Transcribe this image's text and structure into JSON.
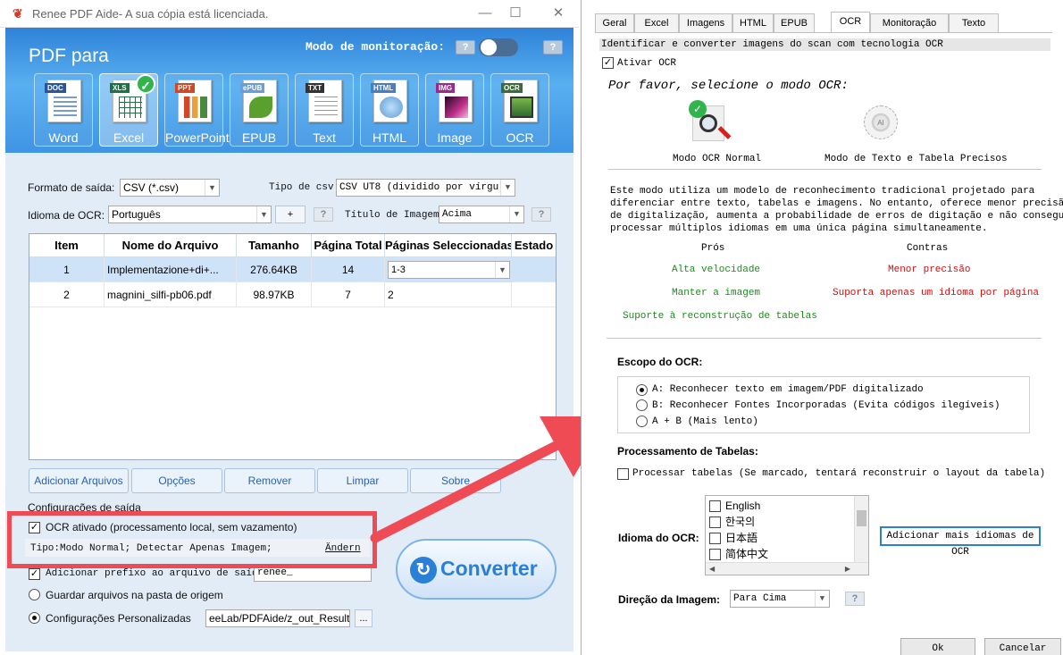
{
  "left_window": {
    "title": "Renee PDF Aide- A sua cópia está licenciada.",
    "app_icon": "renee-logo-icon",
    "banner": {
      "heading": "PDF para",
      "monitor_label": "Modo de monitoração:",
      "help_glyph": "?",
      "formats": [
        {
          "label": "Word",
          "tag": "DOC",
          "tag_color": "#2b5797"
        },
        {
          "label": "Excel",
          "tag": "XLS",
          "tag_color": "#1e7145"
        },
        {
          "label": "PowerPoint",
          "tag": "PPT",
          "tag_color": "#d24726"
        },
        {
          "label": "EPUB",
          "tag": "ePUB",
          "tag_color": "#6a9ed8"
        },
        {
          "label": "Text",
          "tag": "TXT",
          "tag_color": "#333333"
        },
        {
          "label": "HTML",
          "tag": "HTML",
          "tag_color": "#4a7ec0"
        },
        {
          "label": "Image",
          "tag": "IMG",
          "tag_color": "#9b2a8c"
        },
        {
          "label": "OCR",
          "tag": "OCR",
          "tag_color": "#3d6b3d"
        }
      ],
      "selected_format": "Excel"
    },
    "output_format_label": "Formato de saída:",
    "output_format_value": "CSV (*.csv)",
    "csv_type_label": "Tipo de csv:",
    "csv_type_value": "CSV UT8 (dividido por vírgu",
    "ocr_lang_label": "Idioma de OCR:",
    "ocr_lang_value": "Português",
    "plus_label": "+",
    "image_title_label": "Título de Imagem:",
    "image_title_value": "Acima",
    "table": {
      "headers": [
        "Item",
        "Nome do Arquivo",
        "Tamanho",
        "Página Total",
        "Páginas Seleccionadas",
        "Estado"
      ],
      "rows": [
        {
          "item": "1",
          "name": "Implementazione+di+...",
          "size": "276.64KB",
          "total": "14",
          "selected": "1-3",
          "status": ""
        },
        {
          "item": "2",
          "name": "magnini_silfi-pb06.pdf",
          "size": "98.97KB",
          "total": "7",
          "selected": "2",
          "status": ""
        }
      ]
    },
    "buttons": {
      "add_files": "Adicionar Arquivos",
      "options": "Opções",
      "remove": "Remover",
      "clear": "Limpar",
      "about": "Sobre",
      "convert": "Converter"
    },
    "output_settings": {
      "heading": "Configurações de saída",
      "ocr_enabled": "OCR ativado (processamento local, sem vazamento)",
      "ocr_type": "Tipo:Modo Normal; Detectar Apenas Imagem;",
      "change_link": "Ändern",
      "prefix_label": "Adicionar prefixo ao arquivo de saída",
      "prefix_value": "renee_",
      "save_origin": "Guardar arquivos na pasta de origem",
      "custom_settings": "Configurações Personalizadas",
      "custom_path": "eeLab/PDFAide/z_out_Result",
      "browse": "..."
    }
  },
  "dialog": {
    "tabs": [
      "Geral",
      "Excel",
      "Imagens",
      "HTML",
      "EPUB",
      "OCR",
      "Monitoração",
      "Texto"
    ],
    "active_tab": "OCR",
    "section_title": "Identificar e converter imagens do scan com tecnologia OCR",
    "activate_ocr": "Ativar OCR",
    "select_mode": "Por favor, selecione o modo OCR:",
    "mode_normal": "Modo OCR Normal",
    "mode_precise": "Modo de Texto e Tabela Precisos",
    "description": [
      "Este modo utiliza um modelo de reconhecimento tradicional projetado para",
      "diferenciar entre texto, tabelas e imagens. No entanto, oferece menor precisão",
      "de digitalização, aumenta a probabilidade de erros de digitação e não consegue",
      "processar múltiplos idiomas em uma única página simultaneamente."
    ],
    "pros_label": "Prós",
    "cons_label": "Contras",
    "pros": [
      "Alta velocidade",
      "Manter a imagem",
      "Suporte à reconstrução de tabelas"
    ],
    "cons": [
      "Menor precisão",
      "Suporta apenas um idioma por página"
    ],
    "scope_label": "Escopo do OCR:",
    "scope_options": [
      "A: Reconhecer texto em imagem/PDF digitalizado",
      "B: Reconhecer Fontes Incorporadas (Evita códigos ilegíveis)",
      "A + B (Mais lento)"
    ],
    "table_processing_label": "Processamento de Tabelas:",
    "process_tables": "Processar tabelas (Se marcado, tentará reconstruir o layout da tabela)",
    "ocr_language_label": "Idioma do OCR:",
    "languages": [
      "English",
      "한국의",
      "日本語",
      "简体中文"
    ],
    "add_languages": "Adicionar mais idiomas de OCR",
    "direction_label": "Direção da Imagem:",
    "direction_value": "Para Cima",
    "help_glyph": "?",
    "ok": "Ok",
    "cancel": "Cancelar"
  },
  "colors": {
    "banner": "#3f95e3",
    "highlight_box": "#ee4b55",
    "arrow": "#ee4b55",
    "accent_blue": "#2a7fd6",
    "pros_green": "#1e8a1e",
    "cons_red": "#d01010"
  }
}
